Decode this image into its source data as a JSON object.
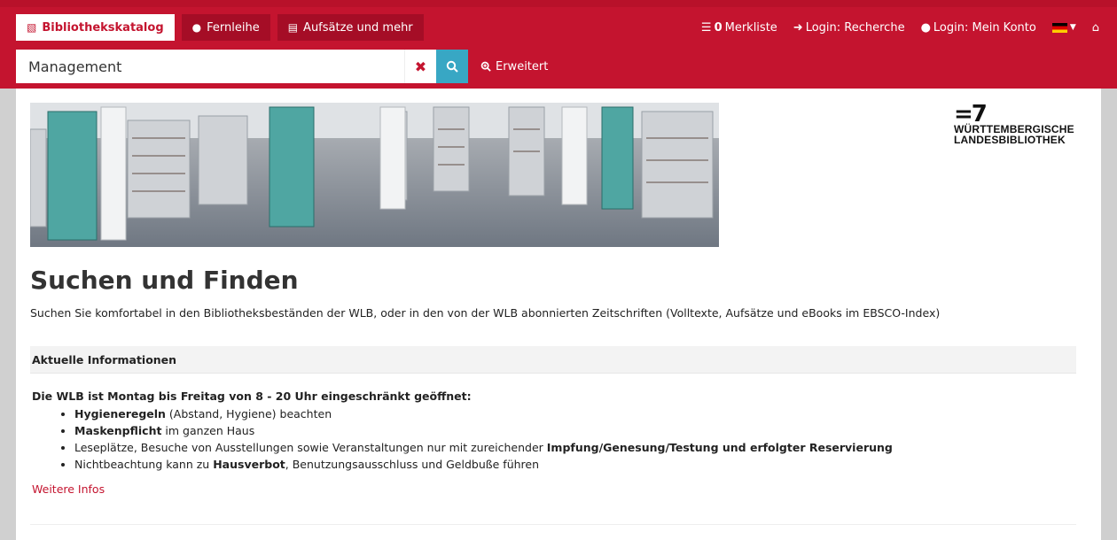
{
  "tabs": [
    {
      "label": "Bibliothekskatalog",
      "icon": "book-icon"
    },
    {
      "label": "Fernleihe",
      "icon": "globe-icon"
    },
    {
      "label": "Aufsätze und mehr",
      "icon": "newspaper-icon"
    }
  ],
  "rightnav": {
    "merkliste_count": "0",
    "merkliste_label": "Merkliste",
    "login_recherche": "Login: Recherche",
    "login_konto": "Login: Mein Konto"
  },
  "search": {
    "value": "Management",
    "advanced_label": "Erweitert"
  },
  "logo": {
    "mark": "=7",
    "line1": "WÜRTTEMBERGISCHE",
    "line2": "LANDESBIBLIOTHEK"
  },
  "main": {
    "title": "Suchen und Finden",
    "intro": "Suchen Sie komfortabel in den Bibliotheksbeständen der WLB, oder in den von der WLB abonnierten Zeitschriften (Volltexte, Aufsätze und eBooks im EBSCO-Index)"
  },
  "info": {
    "heading": "Aktuelle Informationen",
    "lead": "Die WLB ist Montag bis Freitag von 8 - 20 Uhr eingeschränkt geöffnet:",
    "items": [
      {
        "bold": "Hygieneregeln",
        "text": " (Abstand, Hygiene) beachten"
      },
      {
        "bold": "Maskenpflicht",
        "text": " im ganzen Haus"
      },
      {
        "pre": "Leseplätze, Besuche von Ausstellungen sowie Veranstaltungen nur mit zureichender ",
        "bold": "Impfung/Genesung/Testung und erfolgter Reservierung"
      },
      {
        "pre": "Nichtbeachtung kann zu ",
        "bold": "Hausverbot",
        "text": ", Benutzungsausschluss und Geldbuße führen"
      }
    ],
    "more_link": "Weitere Infos"
  }
}
